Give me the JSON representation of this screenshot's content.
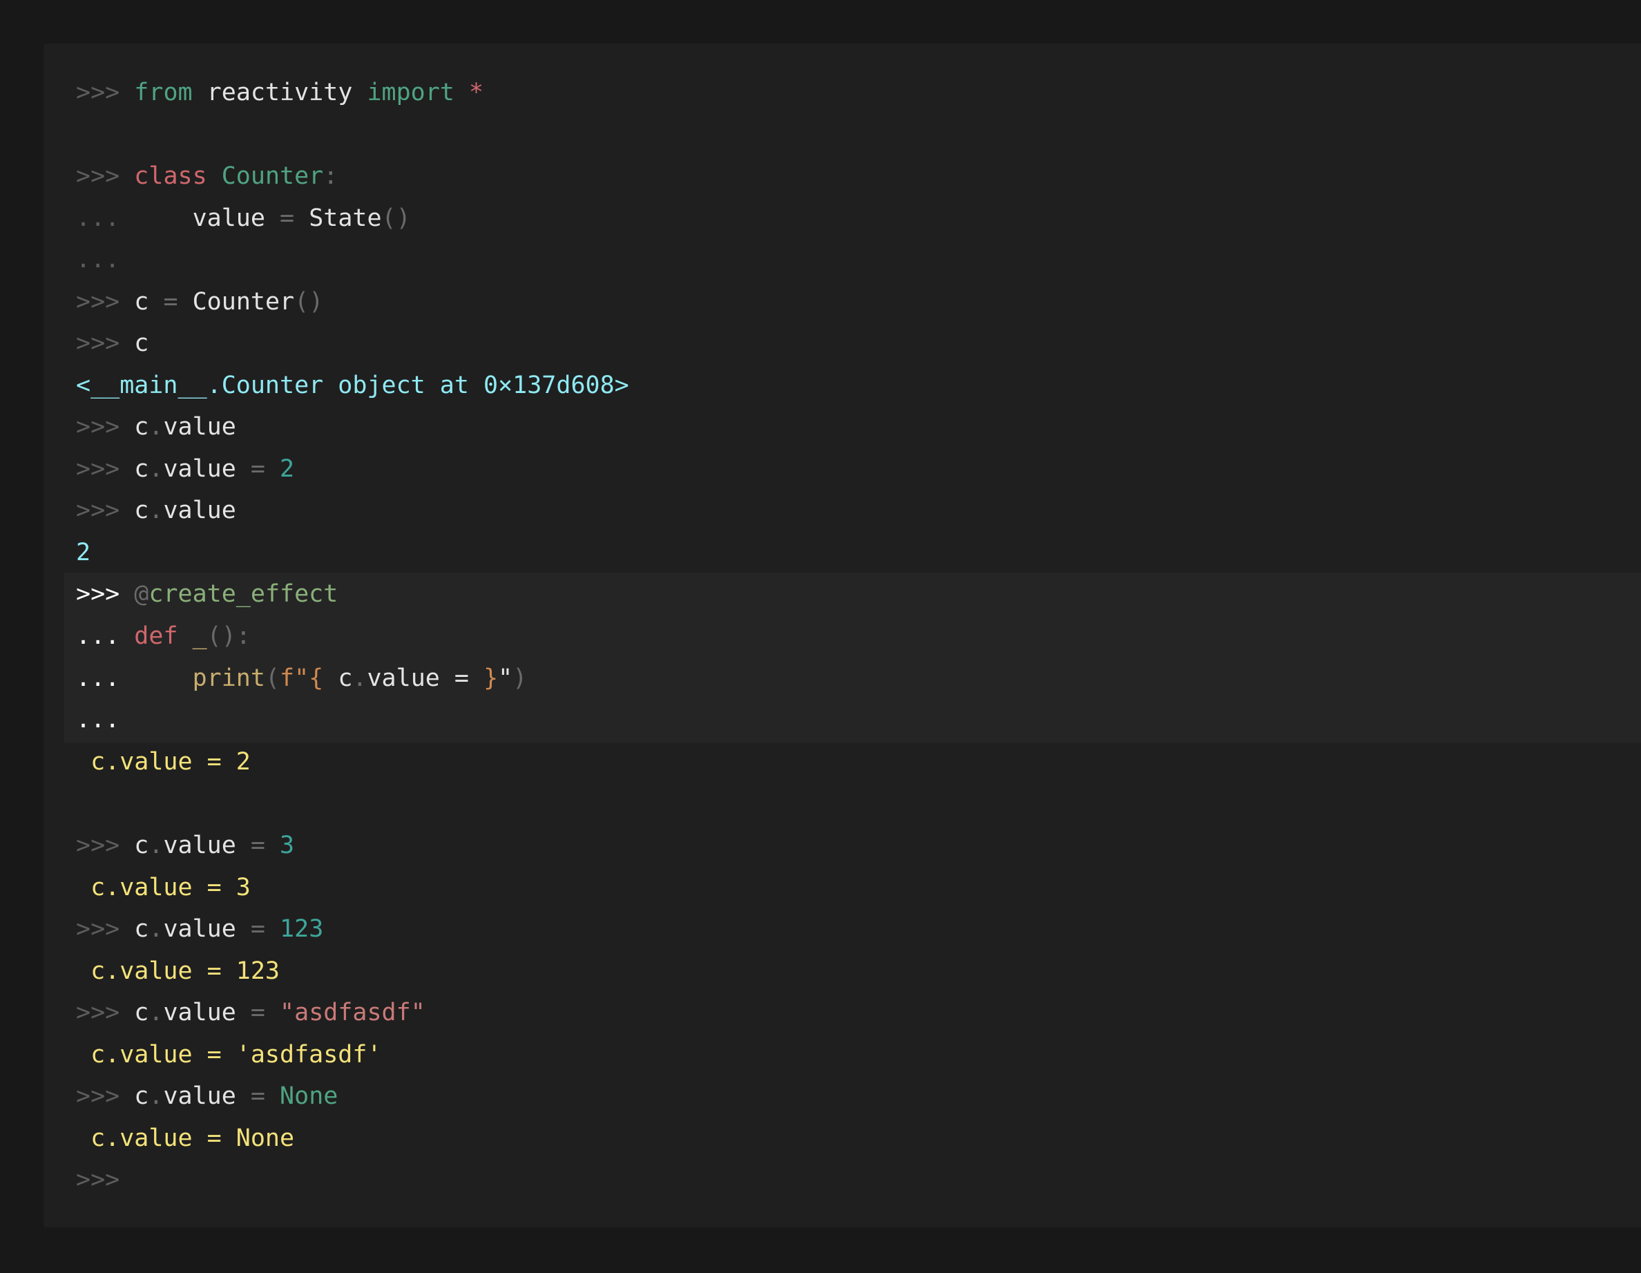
{
  "theme": {
    "background": "#181818",
    "panel": "#1f1f1f",
    "prompt": "#5d5d5d",
    "output_cyan": "#8fe9f2",
    "output_yellow": "#f4e27a"
  },
  "repl": {
    "prompt_primary": ">>>",
    "prompt_continue": "...",
    "l1": {
      "kw_from": "from",
      "module": "reactivity",
      "kw_import": "import",
      "star": "*"
    },
    "l2": {
      "kw_class": "class",
      "name": "Counter",
      "colon": ":"
    },
    "l3": {
      "indent": "    ",
      "attr": "value",
      "eq": "=",
      "call": "State",
      "parens": "()"
    },
    "l5": {
      "var": "c",
      "eq": "=",
      "call": "Counter",
      "parens": "()"
    },
    "l6": {
      "var": "c"
    },
    "o1": "<__main__.Counter object at 0×137d608>",
    "l7": {
      "obj": "c",
      "dot": ".",
      "attr": "value"
    },
    "l8": {
      "obj": "c",
      "dot": ".",
      "attr": "value",
      "eq": "=",
      "val": "2"
    },
    "l9": {
      "obj": "c",
      "dot": ".",
      "attr": "value"
    },
    "o2": "2",
    "l10": {
      "at": "@",
      "name": "create_effect"
    },
    "l11": {
      "kw_def": "def",
      "name": "_",
      "parens": "():"
    },
    "l12": {
      "indent": "    ",
      "fn": "print",
      "open": "(",
      "fpre": "f\"{",
      "expr_obj": " c",
      "expr_dot": ".",
      "expr_rest": "value = ",
      "close_brace": "}",
      "close_quote": "\"",
      "close": ")"
    },
    "o3": " c.value = 2",
    "l14": {
      "obj": "c",
      "dot": ".",
      "attr": "value",
      "eq": "=",
      "val": "3"
    },
    "o4": " c.value = 3",
    "l15": {
      "obj": "c",
      "dot": ".",
      "attr": "value",
      "eq": "=",
      "val": "123"
    },
    "o5": " c.value = 123",
    "l16": {
      "obj": "c",
      "dot": ".",
      "attr": "value",
      "eq": "=",
      "val": "\"asdfasdf\""
    },
    "o6": " c.value = 'asdfasdf'",
    "l17": {
      "obj": "c",
      "dot": ".",
      "attr": "value",
      "eq": "=",
      "val": "None"
    },
    "o7": " c.value = None"
  }
}
